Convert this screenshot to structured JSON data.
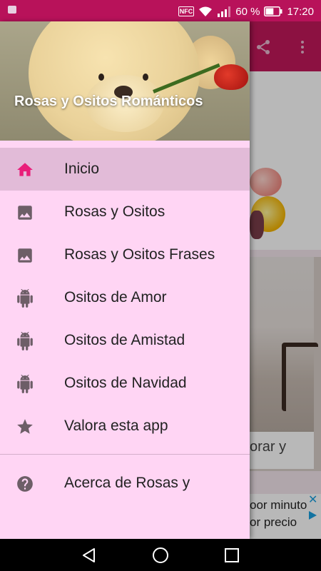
{
  "status_bar": {
    "nfc": "NFC",
    "battery_percent": "60 %",
    "time": "17:20",
    "signal_bars": 3,
    "battery_level": 0.6,
    "color": "#b8125a"
  },
  "app_toolbar": {
    "color": "#c2185b",
    "icons": [
      "share-icon",
      "more-vert-icon"
    ]
  },
  "background_content": {
    "card_text": "orar y",
    "ad_line1": "oor minuto",
    "ad_line2": "or precio"
  },
  "drawer": {
    "background": "#ffd5f4",
    "header_title": "Rosas y Ositos Románticos",
    "items": [
      {
        "label": "Inicio",
        "icon": "home-icon",
        "active": true
      },
      {
        "label": "Rosas y Ositos",
        "icon": "image-icon",
        "active": false
      },
      {
        "label": "Rosas y Ositos Frases",
        "icon": "image-icon",
        "active": false
      },
      {
        "label": "Ositos de Amor",
        "icon": "android-icon",
        "active": false
      },
      {
        "label": "Ositos de Amistad",
        "icon": "android-icon",
        "active": false
      },
      {
        "label": "Ositos de Navidad",
        "icon": "android-icon",
        "active": false
      },
      {
        "label": "Valora esta app",
        "icon": "star-icon",
        "active": false
      }
    ],
    "footer_items": [
      {
        "label": "Acerca de Rosas y",
        "icon": "help-icon"
      }
    ],
    "accent": "#e91e7a"
  },
  "nav_bar": {
    "buttons": [
      "back-icon",
      "home-circle-icon",
      "recents-icon"
    ]
  }
}
